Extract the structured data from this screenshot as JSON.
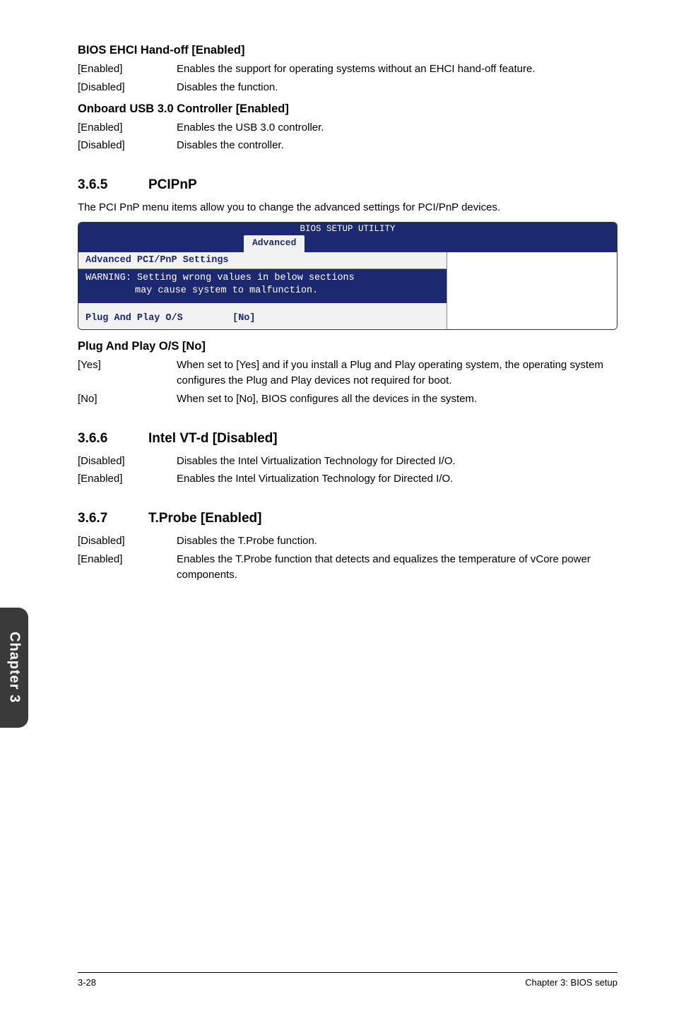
{
  "s1": {
    "title": "BIOS EHCI Hand-off [Enabled]",
    "r1l": "[Enabled]",
    "r1t": "Enables the support for operating systems without an EHCI hand-off feature.",
    "r2l": "[Disabled]",
    "r2t": "Disables the function."
  },
  "s2": {
    "title": "Onboard USB 3.0 Controller [Enabled]",
    "r1l": "[Enabled]",
    "r1t": "Enables the USB 3.0 controller.",
    "r2l": "[Disabled]",
    "r2t": "Disables the controller."
  },
  "sec365": {
    "num": "3.6.5",
    "title": "PCIPnP",
    "para": "The PCI PnP menu items allow you to change the advanced settings for PCI/PnP devices."
  },
  "bios": {
    "util": "BIOS SETUP UTILITY",
    "tab": "Advanced",
    "heading": "Advanced PCI/PnP Settings",
    "warn1": "WARNING: Setting wrong values in below sections",
    "warn2": "may cause system to malfunction.",
    "rowk": "Plug And Play O/S",
    "rowv": "[No]"
  },
  "s3": {
    "title": "Plug And Play O/S [No]",
    "r1l": "[Yes]",
    "r1t": "When set to [Yes] and if you install a Plug and Play operating system, the operating system configures the Plug and Play devices not required for boot.",
    "r2l": "[No]",
    "r2t": "When set to [No], BIOS configures all the devices in the system."
  },
  "sec366": {
    "num": "3.6.6",
    "title": "Intel VT-d [Disabled]",
    "r1l": "[Disabled]",
    "r1t": "Disables the Intel Virtualization Technology for Directed I/O.",
    "r2l": "[Enabled]",
    "r2t": "Enables the Intel Virtualization Technology for Directed I/O."
  },
  "sec367": {
    "num": "3.6.7",
    "title": "T.Probe [Enabled]",
    "r1l": "[Disabled]",
    "r1t": "Disables the T.Probe function.",
    "r2l": "[Enabled]",
    "r2t": "Enables the T.Probe function that detects and equalizes the temperature of vCore power components."
  },
  "sidebar": "Chapter 3",
  "footer": {
    "left": "3-28",
    "right": "Chapter 3: BIOS setup"
  }
}
